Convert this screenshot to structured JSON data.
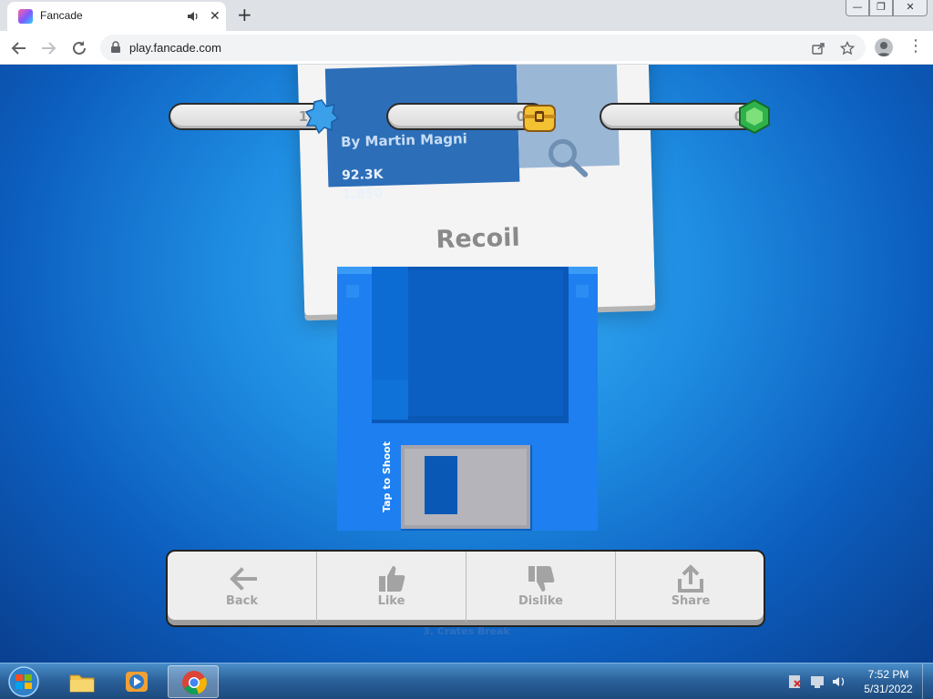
{
  "browser": {
    "tab_title": "Fancade",
    "new_tab_symbol": "+",
    "close_symbol": "✕",
    "url": "play.fancade.com",
    "window_controls": {
      "minimize": "—",
      "maximize": "❐",
      "close": "✕"
    }
  },
  "game_card": {
    "author": "By Martin Magni",
    "stat_plays": "92.3K",
    "stat_likes": "1,850",
    "title": "Recoil"
  },
  "stats_bar": [
    {
      "value": "1",
      "icon": "star-badge-icon",
      "color": "#3aa0ea"
    },
    {
      "value": "0",
      "icon": "treasure-chest-icon",
      "color": "#f2c232"
    },
    {
      "value": "0",
      "icon": "green-gem-icon",
      "color": "#2fb24a"
    }
  ],
  "floppy": {
    "side_label": "Tap to Shoot"
  },
  "actions": [
    {
      "label": "Back",
      "icon": "arrow-left-icon"
    },
    {
      "label": "Like",
      "icon": "thumbs-up-icon"
    },
    {
      "label": "Dislike",
      "icon": "thumbs-down-icon"
    },
    {
      "label": "Share",
      "icon": "share-icon"
    }
  ],
  "ghost_label": "3. Crates Break",
  "taskbar": {
    "time": "7:52 PM",
    "date": "5/31/2022"
  }
}
